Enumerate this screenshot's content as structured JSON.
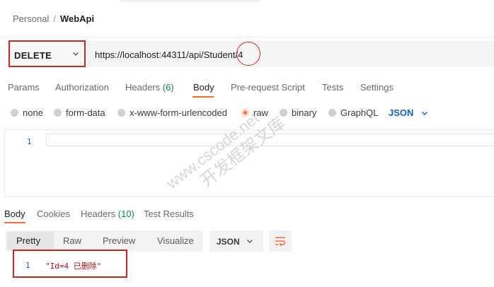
{
  "breadcrumb": {
    "parent": "Personal",
    "separator": "/",
    "current": "WebApi"
  },
  "request": {
    "method": "DELETE",
    "url": "https://localhost:44311/api/Student/4"
  },
  "request_tabs": [
    {
      "label": "Params"
    },
    {
      "label": "Authorization"
    },
    {
      "label": "Headers",
      "count": "(6)"
    },
    {
      "label": "Body",
      "active": true
    },
    {
      "label": "Pre-request Script"
    },
    {
      "label": "Tests"
    },
    {
      "label": "Settings"
    }
  ],
  "body_modes": {
    "options": [
      "none",
      "form-data",
      "x-www-form-urlencoded",
      "raw",
      "binary",
      "GraphQL"
    ],
    "selected": "raw",
    "format": "JSON"
  },
  "editor": {
    "line_number": "1",
    "content": ""
  },
  "response_tabs": [
    {
      "label": "Body",
      "active": true
    },
    {
      "label": "Cookies"
    },
    {
      "label": "Headers",
      "count": "(10)"
    },
    {
      "label": "Test Results"
    }
  ],
  "response_view": {
    "modes": [
      "Pretty",
      "Raw",
      "Preview",
      "Visualize"
    ],
    "selected": "Pretty",
    "format": "JSON"
  },
  "response_body": {
    "line_number": "1",
    "content": "\"Id=4 已删除\""
  },
  "watermark": {
    "line1": "www.cscode.net",
    "line2": "开发框架文库"
  },
  "colors": {
    "accent": "#ff6c37",
    "highlight_red": "#c62828",
    "link_blue": "#1a5ebd",
    "count_green": "#0a8a3c",
    "string_red": "#a31515"
  }
}
